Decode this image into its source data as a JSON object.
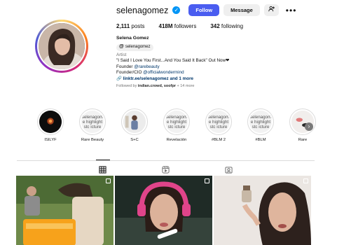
{
  "profile": {
    "username": "selenagomez",
    "verified": true,
    "follow_label": "Follow",
    "message_label": "Message",
    "posts_count": "2,111",
    "posts_label": "posts",
    "followers_count": "418M",
    "followers_label": "followers",
    "following_count": "342",
    "following_label": "following",
    "full_name": "Selena Gomez",
    "threads_handle": "selenagomez",
    "category": "Artist",
    "bio_line1": "\"I Said I Love You First...And You Said It Back\" Out Now❤",
    "bio_founder_prefix": "Founder ",
    "bio_founder_mention": "@rarebeauty",
    "bio_cio_prefix": "Founder/CIO ",
    "bio_cio_mention": "@officialwondermind",
    "link": "linktr.ee/selenagomez and 1 more",
    "followed_by_prefix": "Followed by ",
    "followed_by_names": "indian.crowd, soofpr",
    "followed_by_suffix": " + 14 more"
  },
  "highlights": [
    {
      "label": "ISILYF",
      "thumb": "photo"
    },
    {
      "label": "Rare Beauty",
      "thumb": "selenagome highlight stc icture"
    },
    {
      "label": "S+C",
      "thumb": "photo"
    },
    {
      "label": "Revelación",
      "thumb": "selenagome highlight stc icture"
    },
    {
      "label": "#BLM 2",
      "thumb": "selenagome highlight stc icture"
    },
    {
      "label": "#BLM",
      "thumb": "selenagome highlight stc icture"
    },
    {
      "label": "Rare",
      "thumb": "photo"
    }
  ],
  "tabs": [
    {
      "name": "posts-grid-icon",
      "active": true
    },
    {
      "name": "reels-icon",
      "active": false
    },
    {
      "name": "tagged-icon",
      "active": false
    }
  ],
  "colors": {
    "follow_button": "#4a5df0",
    "verified": "#0095f6",
    "link": "#00376b"
  }
}
